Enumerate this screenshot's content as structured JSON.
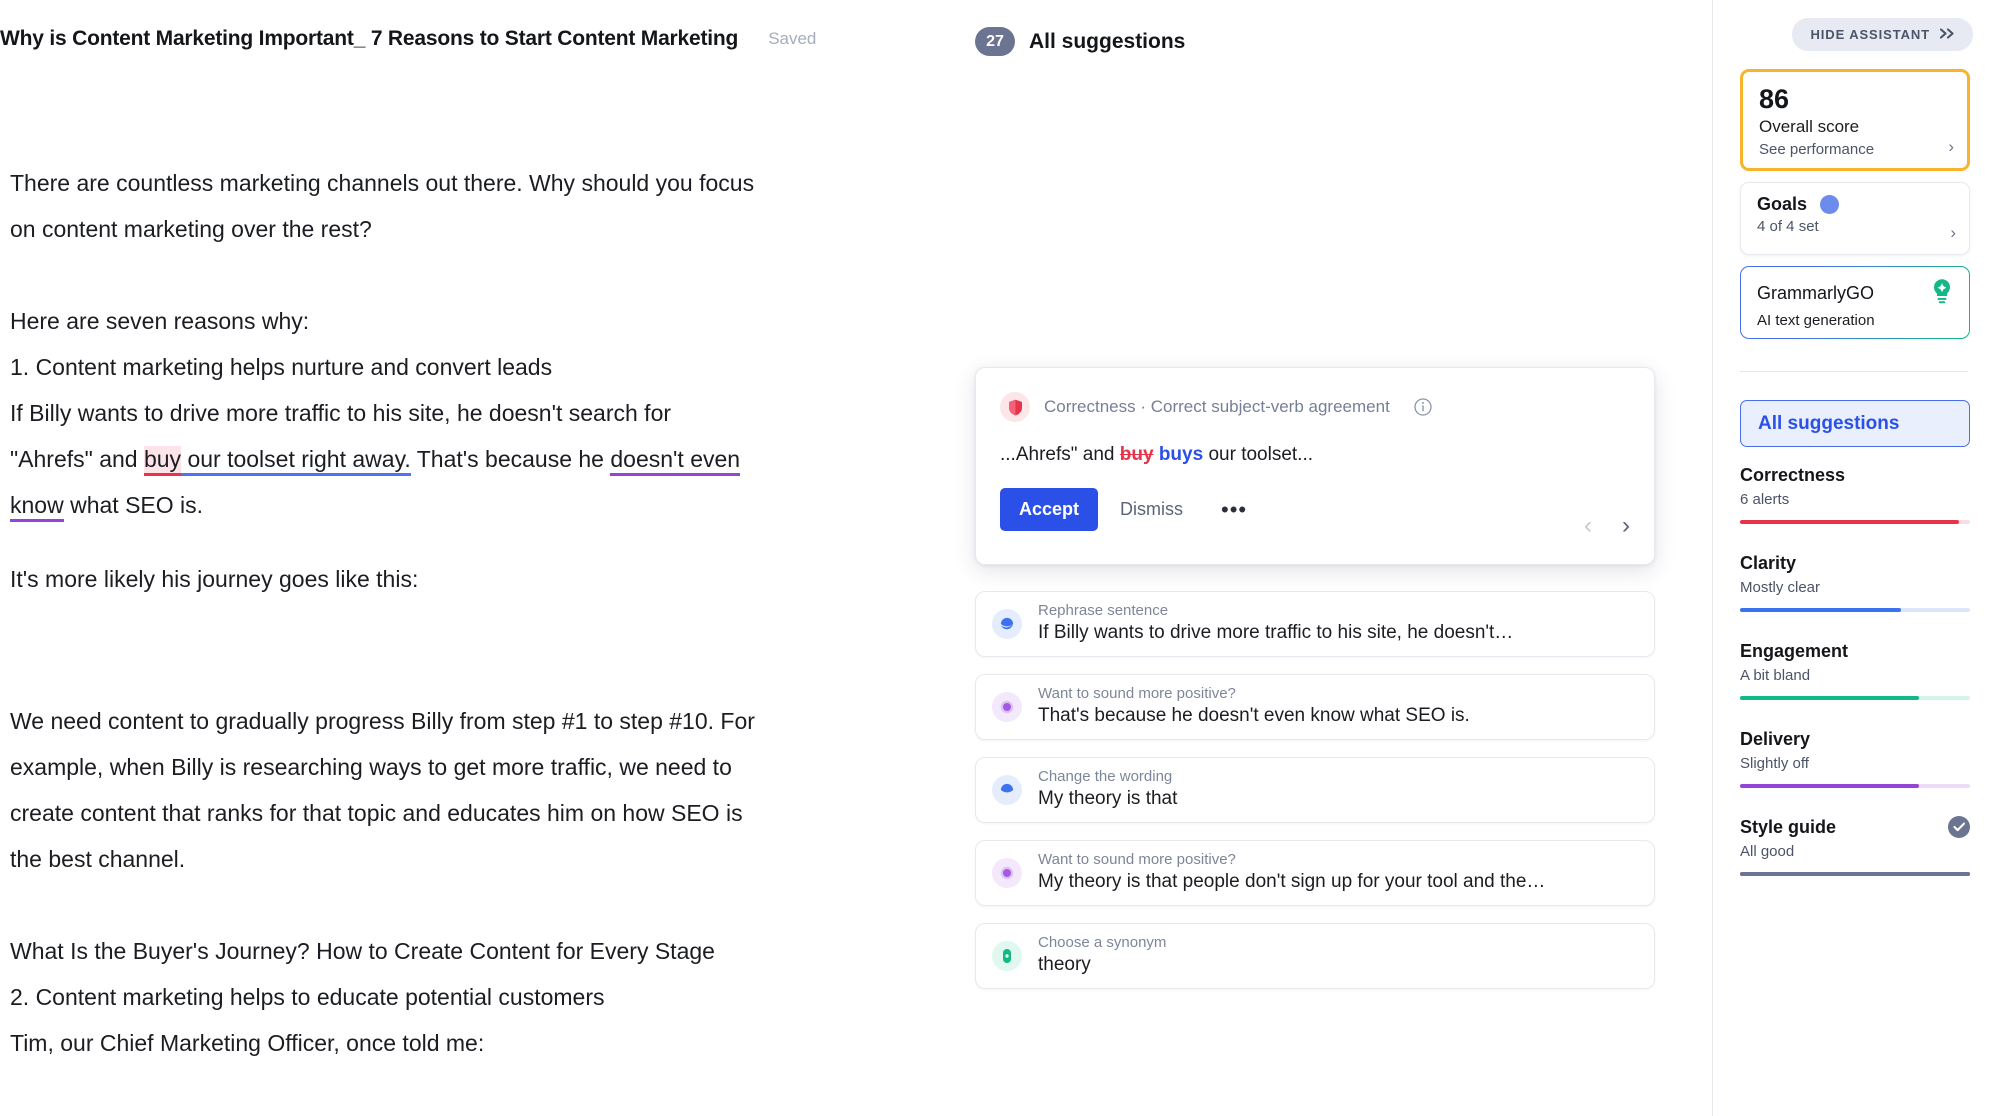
{
  "document": {
    "title": "Why is Content Marketing Important_ 7 Reasons to Start Content Marketing",
    "save_status": "Saved",
    "paragraphs": [
      {
        "lines": [
          "There are countless marketing channels out there. Why should you focus",
          "on content marketing over the rest?"
        ]
      },
      {
        "lines": [
          "Here are seven reasons why:",
          "1. Content marketing helps nurture and convert leads",
          "If Billy wants to drive more traffic to his site, he doesn't search for"
        ]
      },
      {
        "lines": [
          "It's more likely his journey goes like this:"
        ]
      },
      {
        "lines": [
          "We need content to gradually progress Billy from step #1 to step #10. For",
          "example, when Billy is researching ways to get more traffic, we need to",
          "create content that ranks for that topic and educates him on how SEO is",
          "the best channel."
        ]
      },
      {
        "lines": [
          "What Is the Buyer's Journey? How to Create Content for Every Stage",
          "2. Content marketing helps to educate potential customers",
          "Tim, our Chief Marketing Officer, once told me:"
        ]
      }
    ],
    "annotated_line": {
      "prefix": "\"Ahrefs\" and ",
      "error_word": "buy",
      "blue_span": " our toolset right away.",
      "middle": " That's because he ",
      "purple_span_a": "doesn't even",
      "purple_span_b": "know",
      "suffix": " what SEO is."
    }
  },
  "suggestions_panel": {
    "count": "27",
    "header_label": "All suggestions",
    "active_card": {
      "icon": "shield-icon",
      "category": "Correctness · Correct subject-verb agreement",
      "info_icon": "info-icon",
      "preview_prefix": "...Ahrefs\" and ",
      "preview_old": "buy",
      "preview_new": "buys",
      "preview_suffix": " our toolset...",
      "accept_label": "Accept",
      "dismiss_label": "Dismiss",
      "more_label": "•••",
      "prev_icon": "chevron-left-icon",
      "next_icon": "chevron-right-icon"
    },
    "cards": [
      {
        "category": "Rephrase sentence",
        "text": "If Billy wants to drive more traffic to his site, he doesn't…",
        "icon": "clarity-moon-icon",
        "color": "#3b72f0",
        "bg": "#e4ecfd"
      },
      {
        "category": "Want to sound more positive?",
        "text": "That's because he doesn't even know what SEO is.",
        "icon": "engagement-dot-icon",
        "color": "#a35ae0",
        "bg": "#f3e8fc"
      },
      {
        "category": "Change the wording",
        "text": "My theory is that",
        "icon": "clarity-moon-icon",
        "color": "#3b72f0",
        "bg": "#e4ecfd"
      },
      {
        "category": "Want to sound more positive?",
        "text": "My theory is that people don't sign up for your tool and the…",
        "icon": "engagement-dot-icon",
        "color": "#a35ae0",
        "bg": "#f3e8fc"
      },
      {
        "category": "Choose a synonym",
        "text": "theory",
        "icon": "vocabulary-pill-icon",
        "color": "#12b886",
        "bg": "#e0f8ef"
      }
    ]
  },
  "sidebar": {
    "hide_assistant_label": "HIDE ASSISTANT",
    "hide_assistant_icon": "chevrons-right-icon",
    "score_card": {
      "score": "86",
      "label": "Overall score",
      "link": "See performance",
      "chevron_icon": "chevron-right-icon",
      "border_color": "#f7b32b"
    },
    "goals_card": {
      "title": "Goals",
      "sub": "4 of 4 set",
      "dot_icon": "goals-dot-icon",
      "dot_color": "#6c8ced",
      "chevron_icon": "chevron-right-icon"
    },
    "grammarly_go_card": {
      "title": "GrammarlyGO",
      "sub": "AI text generation",
      "icon": "lightbulb-icon",
      "icon_color": "#12b886"
    },
    "all_suggestions_pill": "All suggestions",
    "metrics": [
      {
        "title": "Correctness",
        "sub": "6 alerts",
        "fill": 95,
        "color": "#e8344a",
        "track": "#fbdce0",
        "badge": null
      },
      {
        "title": "Clarity",
        "sub": "Mostly clear",
        "fill": 70,
        "color": "#3b72f0",
        "track": "#dbe6fb",
        "badge": null
      },
      {
        "title": "Engagement",
        "sub": "A bit bland",
        "fill": 78,
        "color": "#12b886",
        "track": "#d6f3e7",
        "badge": null
      },
      {
        "title": "Delivery",
        "sub": "Slightly off",
        "fill": 78,
        "color": "#9545d6",
        "track": "#eddcf8",
        "badge": null
      },
      {
        "title": "Style guide",
        "sub": "All good",
        "fill": 100,
        "color": "#6b7490",
        "track": "#6b7490",
        "badge": "check-badge-icon"
      }
    ]
  }
}
